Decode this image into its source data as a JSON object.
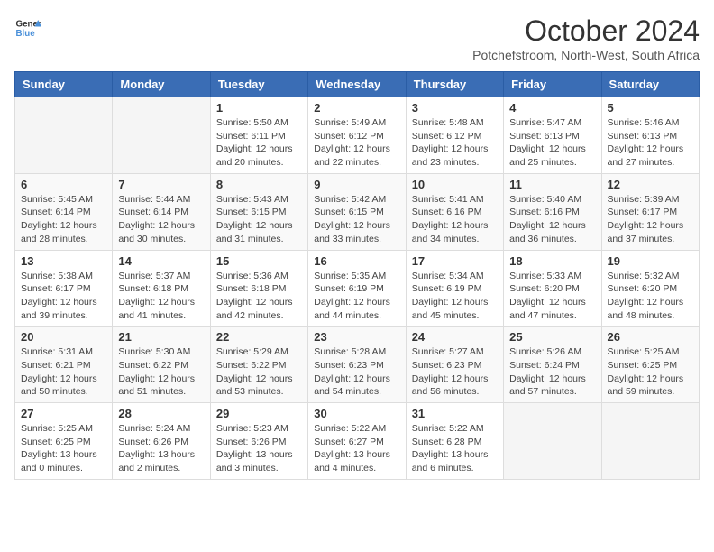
{
  "header": {
    "logo_general": "General",
    "logo_blue": "Blue",
    "title": "October 2024",
    "subtitle": "Potchefstroom, North-West, South Africa"
  },
  "days_of_week": [
    "Sunday",
    "Monday",
    "Tuesday",
    "Wednesday",
    "Thursday",
    "Friday",
    "Saturday"
  ],
  "weeks": [
    [
      {
        "day": "",
        "info": ""
      },
      {
        "day": "",
        "info": ""
      },
      {
        "day": "1",
        "info": "Sunrise: 5:50 AM\nSunset: 6:11 PM\nDaylight: 12 hours and 20 minutes."
      },
      {
        "day": "2",
        "info": "Sunrise: 5:49 AM\nSunset: 6:12 PM\nDaylight: 12 hours and 22 minutes."
      },
      {
        "day": "3",
        "info": "Sunrise: 5:48 AM\nSunset: 6:12 PM\nDaylight: 12 hours and 23 minutes."
      },
      {
        "day": "4",
        "info": "Sunrise: 5:47 AM\nSunset: 6:13 PM\nDaylight: 12 hours and 25 minutes."
      },
      {
        "day": "5",
        "info": "Sunrise: 5:46 AM\nSunset: 6:13 PM\nDaylight: 12 hours and 27 minutes."
      }
    ],
    [
      {
        "day": "6",
        "info": "Sunrise: 5:45 AM\nSunset: 6:14 PM\nDaylight: 12 hours and 28 minutes."
      },
      {
        "day": "7",
        "info": "Sunrise: 5:44 AM\nSunset: 6:14 PM\nDaylight: 12 hours and 30 minutes."
      },
      {
        "day": "8",
        "info": "Sunrise: 5:43 AM\nSunset: 6:15 PM\nDaylight: 12 hours and 31 minutes."
      },
      {
        "day": "9",
        "info": "Sunrise: 5:42 AM\nSunset: 6:15 PM\nDaylight: 12 hours and 33 minutes."
      },
      {
        "day": "10",
        "info": "Sunrise: 5:41 AM\nSunset: 6:16 PM\nDaylight: 12 hours and 34 minutes."
      },
      {
        "day": "11",
        "info": "Sunrise: 5:40 AM\nSunset: 6:16 PM\nDaylight: 12 hours and 36 minutes."
      },
      {
        "day": "12",
        "info": "Sunrise: 5:39 AM\nSunset: 6:17 PM\nDaylight: 12 hours and 37 minutes."
      }
    ],
    [
      {
        "day": "13",
        "info": "Sunrise: 5:38 AM\nSunset: 6:17 PM\nDaylight: 12 hours and 39 minutes."
      },
      {
        "day": "14",
        "info": "Sunrise: 5:37 AM\nSunset: 6:18 PM\nDaylight: 12 hours and 41 minutes."
      },
      {
        "day": "15",
        "info": "Sunrise: 5:36 AM\nSunset: 6:18 PM\nDaylight: 12 hours and 42 minutes."
      },
      {
        "day": "16",
        "info": "Sunrise: 5:35 AM\nSunset: 6:19 PM\nDaylight: 12 hours and 44 minutes."
      },
      {
        "day": "17",
        "info": "Sunrise: 5:34 AM\nSunset: 6:19 PM\nDaylight: 12 hours and 45 minutes."
      },
      {
        "day": "18",
        "info": "Sunrise: 5:33 AM\nSunset: 6:20 PM\nDaylight: 12 hours and 47 minutes."
      },
      {
        "day": "19",
        "info": "Sunrise: 5:32 AM\nSunset: 6:20 PM\nDaylight: 12 hours and 48 minutes."
      }
    ],
    [
      {
        "day": "20",
        "info": "Sunrise: 5:31 AM\nSunset: 6:21 PM\nDaylight: 12 hours and 50 minutes."
      },
      {
        "day": "21",
        "info": "Sunrise: 5:30 AM\nSunset: 6:22 PM\nDaylight: 12 hours and 51 minutes."
      },
      {
        "day": "22",
        "info": "Sunrise: 5:29 AM\nSunset: 6:22 PM\nDaylight: 12 hours and 53 minutes."
      },
      {
        "day": "23",
        "info": "Sunrise: 5:28 AM\nSunset: 6:23 PM\nDaylight: 12 hours and 54 minutes."
      },
      {
        "day": "24",
        "info": "Sunrise: 5:27 AM\nSunset: 6:23 PM\nDaylight: 12 hours and 56 minutes."
      },
      {
        "day": "25",
        "info": "Sunrise: 5:26 AM\nSunset: 6:24 PM\nDaylight: 12 hours and 57 minutes."
      },
      {
        "day": "26",
        "info": "Sunrise: 5:25 AM\nSunset: 6:25 PM\nDaylight: 12 hours and 59 minutes."
      }
    ],
    [
      {
        "day": "27",
        "info": "Sunrise: 5:25 AM\nSunset: 6:25 PM\nDaylight: 13 hours and 0 minutes."
      },
      {
        "day": "28",
        "info": "Sunrise: 5:24 AM\nSunset: 6:26 PM\nDaylight: 13 hours and 2 minutes."
      },
      {
        "day": "29",
        "info": "Sunrise: 5:23 AM\nSunset: 6:26 PM\nDaylight: 13 hours and 3 minutes."
      },
      {
        "day": "30",
        "info": "Sunrise: 5:22 AM\nSunset: 6:27 PM\nDaylight: 13 hours and 4 minutes."
      },
      {
        "day": "31",
        "info": "Sunrise: 5:22 AM\nSunset: 6:28 PM\nDaylight: 13 hours and 6 minutes."
      },
      {
        "day": "",
        "info": ""
      },
      {
        "day": "",
        "info": ""
      }
    ]
  ]
}
